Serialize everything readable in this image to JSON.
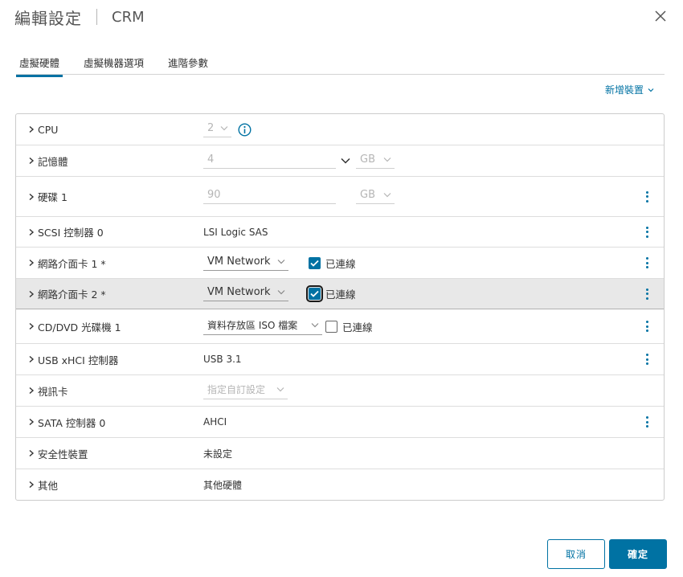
{
  "header": {
    "title": "編輯設定",
    "subtitle": "CRM"
  },
  "tabs": [
    {
      "label": "虛擬硬體",
      "active": true
    },
    {
      "label": "虛擬機器選項",
      "active": false
    },
    {
      "label": "進階參數",
      "active": false
    }
  ],
  "add_device": {
    "label": "新增裝置"
  },
  "rows": {
    "cpu": {
      "label": "CPU",
      "value": "2"
    },
    "memory": {
      "label": "記憶體",
      "value": "4",
      "unit": "GB"
    },
    "disk": {
      "label": "硬碟 1",
      "value": "90",
      "unit": "GB"
    },
    "scsi": {
      "label": "SCSI 控制器 0",
      "value": "LSI Logic SAS"
    },
    "nic1": {
      "label": "網路介面卡 1 *",
      "network": "VM Network",
      "connected_label": "已連線",
      "connected": true
    },
    "nic2": {
      "label": "網路介面卡 2 *",
      "network": "VM Network",
      "connected_label": "已連線",
      "connected": true
    },
    "cdrom": {
      "label": "CD/DVD 光碟機 1",
      "value": "資料存放區 ISO 檔案",
      "connected_label": "已連線",
      "connected": false
    },
    "usb": {
      "label": "USB xHCI 控制器",
      "value": "USB 3.1"
    },
    "video": {
      "label": "視訊卡",
      "value": "指定自訂設定"
    },
    "sata": {
      "label": "SATA 控制器 0",
      "value": "AHCI"
    },
    "security": {
      "label": "安全性裝置",
      "value": "未設定"
    },
    "other": {
      "label": "其他",
      "value": "其他硬體"
    }
  },
  "footer": {
    "cancel_label": "取消",
    "ok_label": "確定"
  },
  "colors": {
    "accent": "#0072a3",
    "selected_row": "#e8e8e8"
  }
}
